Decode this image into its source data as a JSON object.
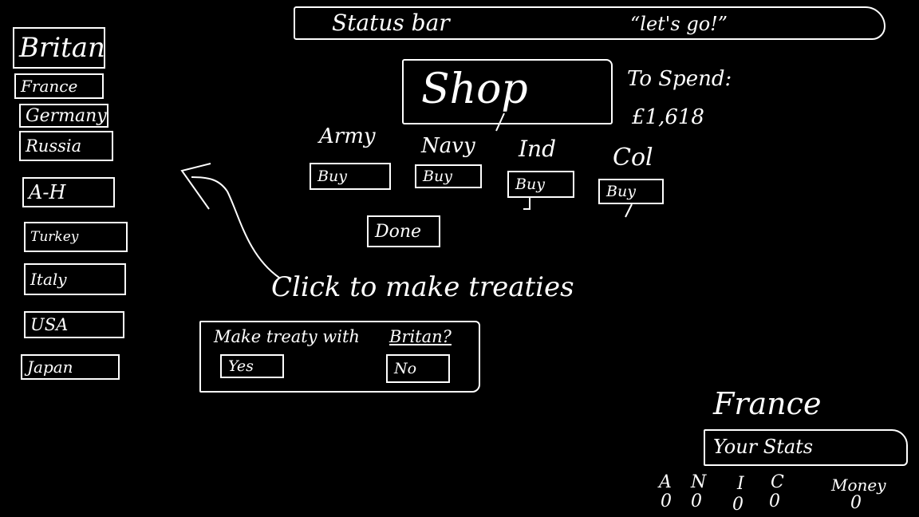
{
  "status_bar": {
    "label": "Status bar",
    "message": "“let's go!”"
  },
  "countries": [
    {
      "label": "Britan"
    },
    {
      "label": "France"
    },
    {
      "label": "Germany"
    },
    {
      "label": "Russia"
    },
    {
      "label": "A-H"
    },
    {
      "label": "Turkey"
    },
    {
      "label": "Italy"
    },
    {
      "label": "USA"
    },
    {
      "label": "Japan"
    }
  ],
  "shop": {
    "title": "Shop",
    "to_spend_label": "To Spend:",
    "to_spend_value": "£1,618",
    "categories": [
      {
        "label": "Army",
        "buy_label": "Buy"
      },
      {
        "label": "Navy",
        "buy_label": "Buy"
      },
      {
        "label": "Ind",
        "buy_label": "Buy"
      },
      {
        "label": "Col",
        "buy_label": "Buy"
      }
    ],
    "done_label": "Done"
  },
  "annotation": {
    "text": "Click to make treaties"
  },
  "treaty_dialog": {
    "prompt": "Make treaty with",
    "target": "Britan?",
    "yes_label": "Yes",
    "no_label": "No"
  },
  "player": {
    "country": "France",
    "stats_label": "Your Stats",
    "stats": [
      {
        "label": "A",
        "value": "0"
      },
      {
        "label": "N",
        "value": "0"
      },
      {
        "label": "I",
        "value": "0"
      },
      {
        "label": "C",
        "value": "0"
      },
      {
        "label": "Money",
        "value": "0"
      }
    ]
  }
}
